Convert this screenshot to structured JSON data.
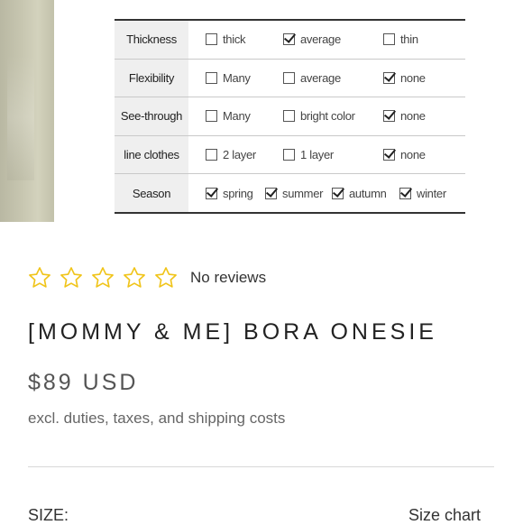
{
  "spec_table": {
    "rows": [
      {
        "label": "Thickness",
        "options": [
          {
            "text": "thick",
            "checked": false
          },
          {
            "text": "average",
            "checked": true
          },
          {
            "text": "thin",
            "checked": false
          }
        ]
      },
      {
        "label": "Flexibility",
        "options": [
          {
            "text": "Many",
            "checked": false
          },
          {
            "text": "average",
            "checked": false
          },
          {
            "text": "none",
            "checked": true
          }
        ]
      },
      {
        "label": "See-through",
        "options": [
          {
            "text": "Many",
            "checked": false
          },
          {
            "text": "bright color",
            "checked": false
          },
          {
            "text": "none",
            "checked": true
          }
        ]
      },
      {
        "label": "line clothes",
        "options": [
          {
            "text": "2 layer",
            "checked": false
          },
          {
            "text": "1 layer",
            "checked": false
          },
          {
            "text": "none",
            "checked": true
          }
        ]
      },
      {
        "label": "Season",
        "options": [
          {
            "text": "spring",
            "checked": true
          },
          {
            "text": "summer",
            "checked": true
          },
          {
            "text": "autumn",
            "checked": true
          },
          {
            "text": "winter",
            "checked": true
          }
        ]
      }
    ]
  },
  "rating": {
    "stars": 5,
    "filled": 0,
    "text": "No reviews",
    "star_color": "#f0c419"
  },
  "product": {
    "title": "[MOMMY & ME] BORA ONESIE",
    "price": "$89 USD",
    "tax_note": "excl. duties, taxes, and shipping costs"
  },
  "size": {
    "label": "SIZE:",
    "chart_link": "Size chart"
  }
}
